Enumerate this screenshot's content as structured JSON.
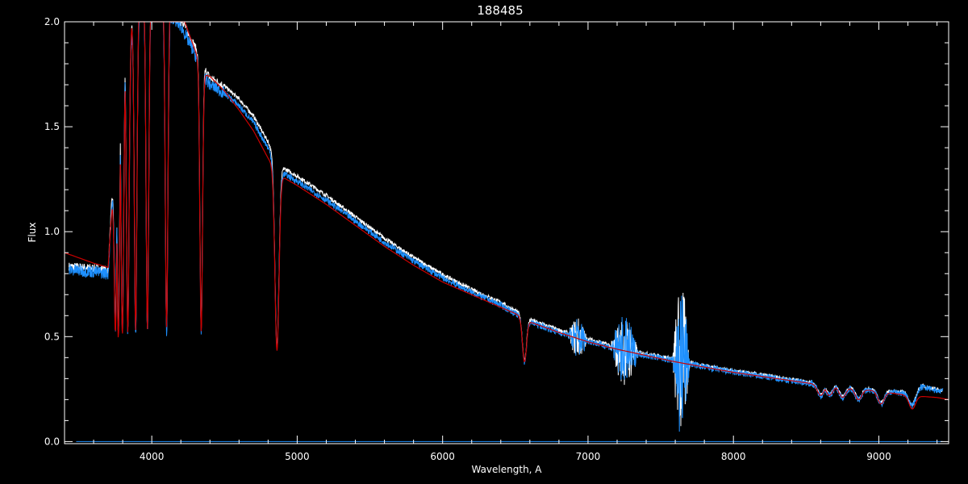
{
  "chart_data": {
    "type": "line",
    "title": "188485",
    "xlabel": "Wavelength, A",
    "ylabel": "Flux",
    "xlim": [
      3400,
      9480
    ],
    "ylim": [
      -0.01,
      2.0
    ],
    "x_ticks": [
      "4000",
      "5000",
      "6000",
      "7000",
      "8000",
      "9000"
    ],
    "y_ticks": [
      "0.0",
      "0.5",
      "1.0",
      "1.5",
      "2.0"
    ],
    "grid": false,
    "background": "#000000",
    "colors": {
      "observed_white": "#ffffff",
      "observed_blue": "#1e90ff",
      "model": "#cc0000",
      "axes": "#ffffff"
    },
    "continuum_observed": [
      [
        3400,
        0.82
      ],
      [
        3600,
        0.81
      ],
      [
        3700,
        0.8
      ],
      [
        3760,
        1.6
      ],
      [
        3800,
        1.85
      ],
      [
        3850,
        1.92
      ],
      [
        3900,
        2.05
      ],
      [
        4000,
        2.08
      ],
      [
        4100,
        2.05
      ],
      [
        4200,
        1.98
      ],
      [
        4300,
        1.84
      ],
      [
        4380,
        1.72
      ],
      [
        4400,
        1.7
      ],
      [
        4500,
        1.66
      ],
      [
        4600,
        1.6
      ],
      [
        4700,
        1.52
      ],
      [
        4800,
        1.4
      ],
      [
        4860,
        1.3
      ],
      [
        4900,
        1.28
      ],
      [
        5000,
        1.24
      ],
      [
        5200,
        1.15
      ],
      [
        5400,
        1.05
      ],
      [
        5600,
        0.95
      ],
      [
        5800,
        0.86
      ],
      [
        6000,
        0.78
      ],
      [
        6200,
        0.71
      ],
      [
        6400,
        0.65
      ],
      [
        6500,
        0.61
      ],
      [
        6600,
        0.57
      ],
      [
        6800,
        0.52
      ],
      [
        7000,
        0.48
      ],
      [
        7200,
        0.44
      ],
      [
        7400,
        0.41
      ],
      [
        7600,
        0.385
      ],
      [
        7800,
        0.355
      ],
      [
        8000,
        0.33
      ],
      [
        8200,
        0.31
      ],
      [
        8400,
        0.29
      ],
      [
        8600,
        0.27
      ],
      [
        8800,
        0.255
      ],
      [
        9000,
        0.24
      ],
      [
        9200,
        0.23
      ],
      [
        9300,
        0.26
      ],
      [
        9420,
        0.24
      ]
    ],
    "continuum_model": [
      [
        3400,
        0.9
      ],
      [
        3600,
        0.85
      ],
      [
        3700,
        0.83
      ],
      [
        3760,
        1.5
      ],
      [
        3800,
        1.8
      ],
      [
        3850,
        1.95
      ],
      [
        3900,
        2.1
      ],
      [
        4000,
        2.15
      ],
      [
        4100,
        2.15
      ],
      [
        4200,
        2.05
      ],
      [
        4300,
        1.86
      ],
      [
        4350,
        1.75
      ],
      [
        4400,
        1.74
      ],
      [
        4500,
        1.67
      ],
      [
        4600,
        1.58
      ],
      [
        4700,
        1.48
      ],
      [
        4800,
        1.35
      ],
      [
        4860,
        1.28
      ],
      [
        4900,
        1.26
      ],
      [
        5000,
        1.22
      ],
      [
        5200,
        1.13
      ],
      [
        5400,
        1.03
      ],
      [
        5600,
        0.93
      ],
      [
        5800,
        0.84
      ],
      [
        6000,
        0.76
      ],
      [
        6200,
        0.7
      ],
      [
        6400,
        0.64
      ],
      [
        6500,
        0.61
      ],
      [
        6600,
        0.57
      ],
      [
        6800,
        0.52
      ],
      [
        7000,
        0.475
      ],
      [
        7200,
        0.44
      ],
      [
        7400,
        0.41
      ],
      [
        7600,
        0.38
      ],
      [
        7800,
        0.355
      ],
      [
        8000,
        0.33
      ],
      [
        8200,
        0.31
      ],
      [
        8400,
        0.29
      ],
      [
        8600,
        0.27
      ],
      [
        8800,
        0.255
      ],
      [
        9000,
        0.24
      ],
      [
        9200,
        0.22
      ],
      [
        9400,
        0.21
      ],
      [
        9480,
        0.2
      ]
    ],
    "absorption_lines": [
      [
        3750,
        0.55
      ],
      [
        3770,
        0.52
      ],
      [
        3798,
        0.52
      ],
      [
        3835,
        0.52
      ],
      [
        3889,
        0.52
      ],
      [
        3970,
        0.52
      ],
      [
        4102,
        0.52
      ],
      [
        4340,
        0.52
      ],
      [
        4861,
        0.44
      ],
      [
        6563,
        0.38
      ],
      [
        8600,
        0.22
      ],
      [
        8660,
        0.22
      ],
      [
        8750,
        0.21
      ],
      [
        8860,
        0.2
      ],
      [
        9015,
        0.18
      ],
      [
        9230,
        0.17
      ]
    ],
    "telluric_bands": [
      {
        "from": 6860,
        "to": 7000,
        "high": 0.62,
        "low": 0.42
      },
      {
        "from": 7150,
        "to": 7350,
        "high": 0.58,
        "low": 0.25
      },
      {
        "from": 7580,
        "to": 7700,
        "high": 0.88,
        "low": 0.11
      }
    ],
    "zero_level": 0.0
  }
}
